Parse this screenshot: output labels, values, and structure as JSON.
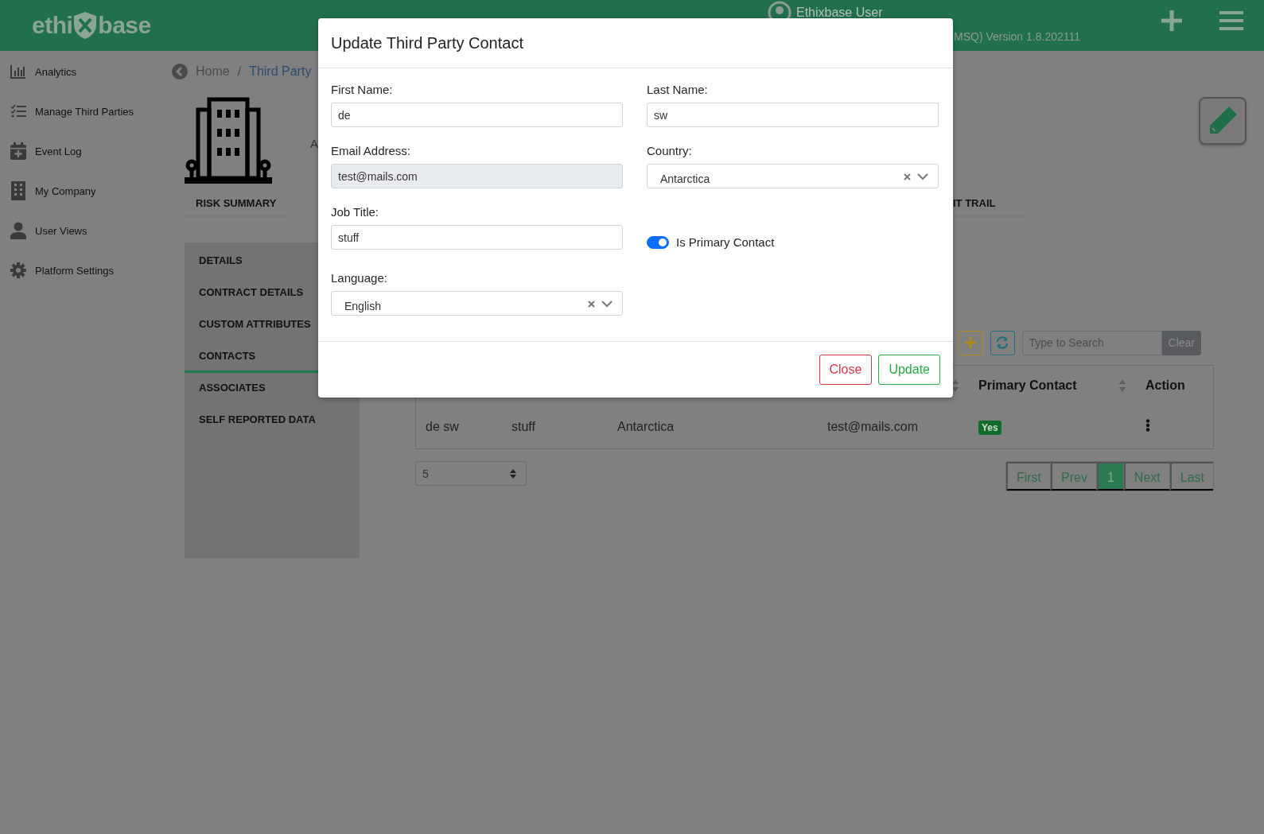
{
  "header": {
    "logo": {
      "left": "ethi",
      "right": "base"
    },
    "user_name": "Ethixbase User",
    "version": "MSQ) Version 1.8.202111"
  },
  "sidebar": {
    "items": [
      {
        "label": "Analytics",
        "kind": "chart"
      },
      {
        "label": "Manage Third Parties",
        "kind": "list"
      },
      {
        "label": "Event Log",
        "kind": "calendar"
      },
      {
        "label": "My Company",
        "kind": "building"
      },
      {
        "label": "User Views",
        "kind": "user"
      },
      {
        "label": "Platform Settings",
        "kind": "gear"
      }
    ]
  },
  "breadcrumb": [
    {
      "label": "Home",
      "kind": "plain"
    },
    {
      "label": "Third Party",
      "kind": "link"
    }
  ],
  "breadcrumb_separator": "/",
  "company": {
    "subtitle": "A"
  },
  "top_tabs": [
    {
      "label": "RISK SUMMARY"
    },
    {
      "label": "IT TRAIL"
    }
  ],
  "side_tabs": [
    {
      "label": "DETAILS",
      "selected": false
    },
    {
      "label": "CONTRACT DETAILS",
      "selected": false
    },
    {
      "label": "CUSTOM ATTRIBUTES",
      "selected": false
    },
    {
      "label": "CONTACTS",
      "selected": true
    },
    {
      "label": "ASSOCIATES",
      "selected": false
    },
    {
      "label": "SELF REPORTED DATA",
      "selected": false
    }
  ],
  "search": {
    "placeholder": "Type to Search",
    "clear": "Clear"
  },
  "table": {
    "columns": [
      {
        "label": "Primary Contact",
        "sortable": true
      },
      {
        "label": "Action",
        "sortable": false
      }
    ],
    "rows": [
      {
        "name": "de sw",
        "job_title": "stuff",
        "country": "Antarctica",
        "email": "test@mails.com",
        "primary_contact": "Yes"
      }
    ]
  },
  "page_size": "5",
  "pagination": [
    {
      "label": "First",
      "selected": false
    },
    {
      "label": "Prev",
      "selected": false
    },
    {
      "label": "1",
      "selected": true
    },
    {
      "label": "Next",
      "selected": false
    },
    {
      "label": "Last",
      "selected": false
    }
  ],
  "modal": {
    "title": "Update Third Party Contact",
    "fields": [
      {
        "kind": "text",
        "label": "First Name:",
        "value": "de",
        "disabled": false
      },
      {
        "kind": "text",
        "label": "Last Name:",
        "value": "sw",
        "disabled": false
      },
      {
        "kind": "text",
        "label": "Email Address:",
        "value": "test@mails.com",
        "disabled": true
      },
      {
        "kind": "select",
        "label": "Country:",
        "value": "Antarctica"
      },
      {
        "kind": "text",
        "label": "Job Title:",
        "value": "stuff",
        "disabled": false
      },
      {
        "kind": "toggle",
        "label": "Is Primary Contact",
        "on": true
      },
      {
        "kind": "select",
        "label": "Language:",
        "value": "English"
      }
    ],
    "buttons": [
      {
        "label": "Close",
        "kind": "danger"
      },
      {
        "label": "Update",
        "kind": "success"
      }
    ]
  }
}
